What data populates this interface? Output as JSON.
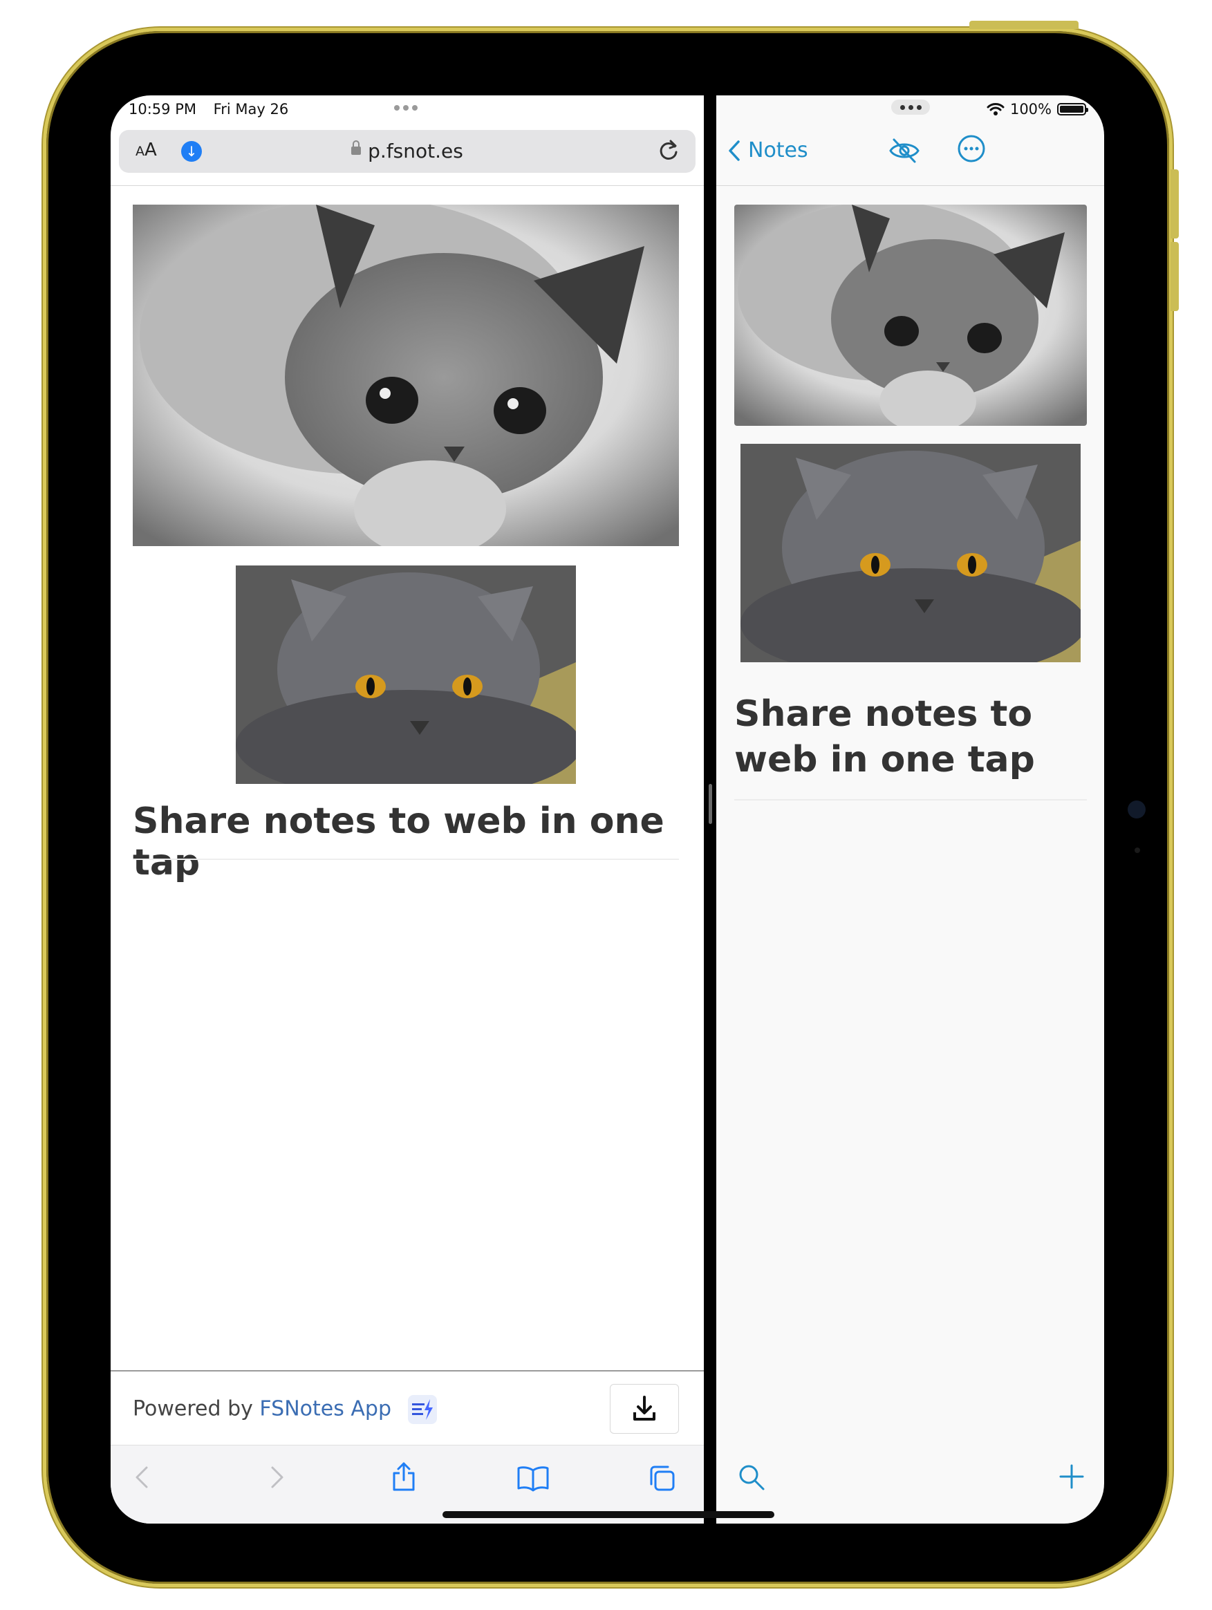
{
  "status_left": {
    "time": "10:59 PM",
    "date": "Fri May 26"
  },
  "safari": {
    "text_size_label": "AA",
    "url": "p.fsnot.es",
    "heading": "Share notes to web in one tap",
    "footer": {
      "powered_prefix": "Powered by ",
      "app_link": "FSNotes App"
    },
    "images": [
      {
        "subject": "grey cat, black and white photo"
      },
      {
        "subject": "grey british shorthair cat with orange eyes"
      }
    ],
    "toolbar": [
      "back-icon",
      "forward-icon",
      "share-icon",
      "bookmarks-icon",
      "tabs-icon"
    ]
  },
  "status_right": {
    "battery_percent": "100%"
  },
  "notes": {
    "back_label": "Notes",
    "heading": "Share notes to web in one tap",
    "toolbar": [
      "search-icon",
      "add-icon"
    ],
    "colors": {
      "accent": "#1f8ec9"
    }
  },
  "device": {
    "frame_color": "#d9c95a"
  }
}
